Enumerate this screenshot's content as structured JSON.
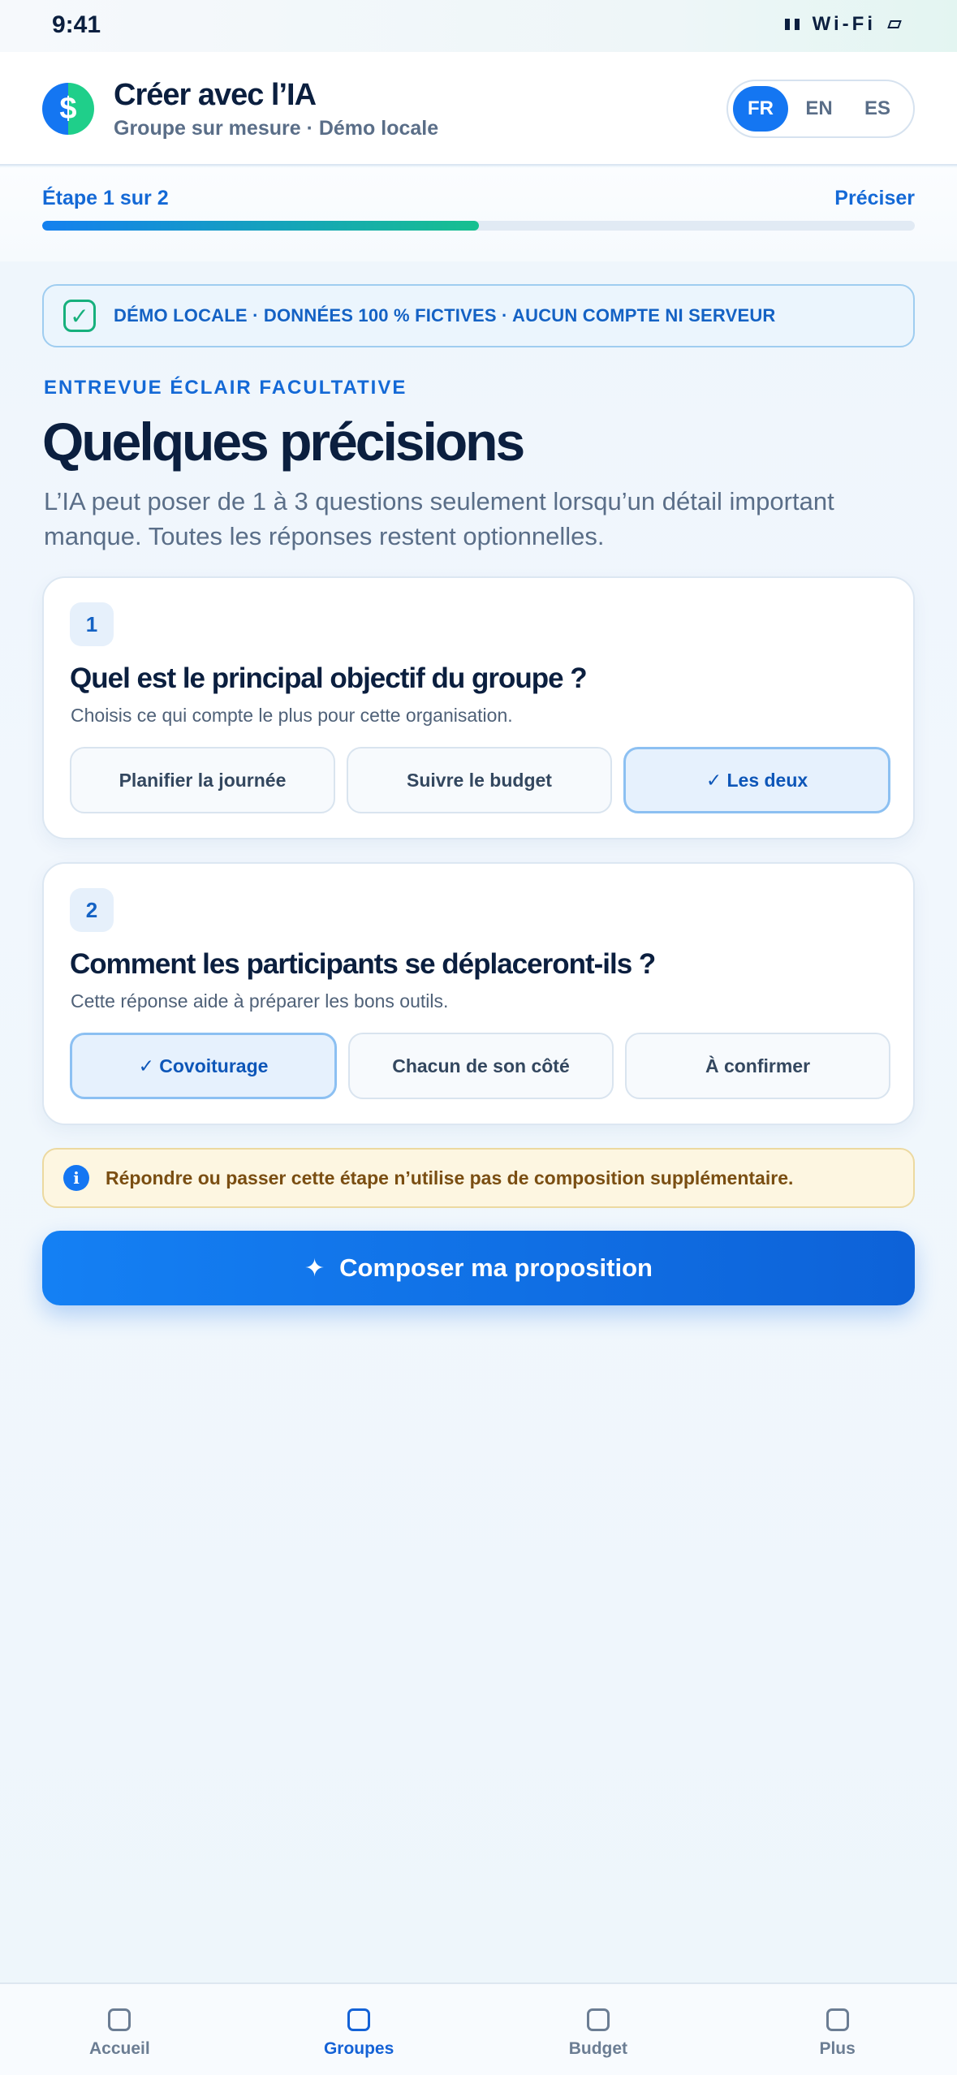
{
  "status_bar": {
    "time": "9:41",
    "network": "Wi-Fi"
  },
  "header": {
    "logo_symbol": "$",
    "title": "Créer avec l’IA",
    "subtitle": "Groupe sur mesure · Démo locale",
    "languages": [
      {
        "code": "FR",
        "active": true
      },
      {
        "code": "EN",
        "active": false
      },
      {
        "code": "ES",
        "active": false
      }
    ]
  },
  "step": {
    "label": "Étape 1 sur 2",
    "next_label": "Préciser",
    "progress": 0.5
  },
  "demo_banner": {
    "text": "DÉMO LOCALE · DONNÉES 100 % FICTIVES · AUCUN COMPTE NI SERVEUR",
    "icon": "check-icon"
  },
  "intro": {
    "eyebrow": "ENTREVUE ÉCLAIR FACULTATIVE",
    "title": "Quelques précisions",
    "description": "L’IA peut poser de 1 à 3 questions seulement lorsqu’un détail important manque. Toutes les réponses restent optionnelles."
  },
  "questions": [
    {
      "number": "1",
      "title": "Quel est le principal objectif du groupe ?",
      "hint": "Choisis ce qui compte le plus pour cette organisation.",
      "options": [
        {
          "label": "Planifier la journée",
          "selected": false
        },
        {
          "label": "Suivre le budget",
          "selected": false
        },
        {
          "label": "✓ Les deux",
          "selected": true
        }
      ]
    },
    {
      "number": "2",
      "title": "Comment les participants se déplaceront-ils ?",
      "hint": "Cette réponse aide à préparer les bons outils.",
      "options": [
        {
          "label": "✓ Covoiturage",
          "selected": true
        },
        {
          "label": "Chacun de son côté",
          "selected": false
        },
        {
          "label": "À confirmer",
          "selected": false
        }
      ]
    }
  ],
  "info_banner": {
    "icon": "info-icon",
    "text": "Répondre ou passer cette étape n’utilise pas de composition supplémentaire."
  },
  "cta": {
    "icon": "sparkle-icon",
    "label": "Composer ma proposition"
  },
  "bottom_nav": [
    {
      "label": "Accueil",
      "active": false
    },
    {
      "label": "Groupes",
      "active": true
    },
    {
      "label": "Budget",
      "active": false
    },
    {
      "label": "Plus",
      "active": false
    }
  ],
  "colors": {
    "accent": "#1476f2",
    "success": "#16b07c",
    "warning_bg": "#fdf6e1"
  }
}
